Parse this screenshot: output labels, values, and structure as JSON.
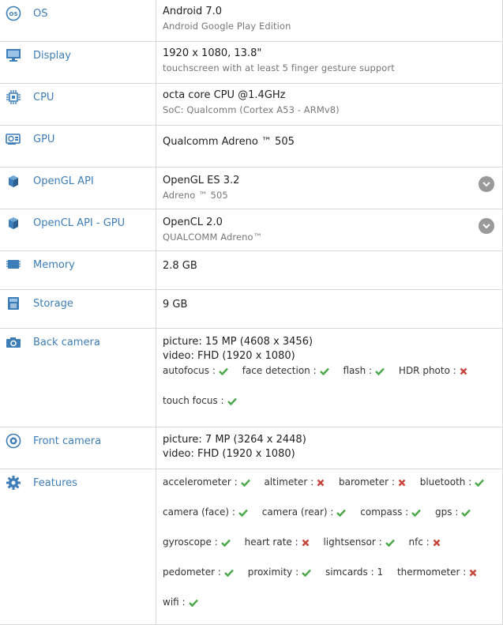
{
  "rows": {
    "os": {
      "label": "OS",
      "main": "Android 7.0",
      "sub": "Android Google Play Edition"
    },
    "display": {
      "label": "Display",
      "main": "1920 x 1080, 13.8\"",
      "sub": "touchscreen with at least 5 finger gesture support"
    },
    "cpu": {
      "label": "CPU",
      "main": "octa core CPU @1.4GHz",
      "sub": "SoC: Qualcomm (Cortex A53 - ARMv8)"
    },
    "gpu": {
      "label": "GPU",
      "main": "Qualcomm Adreno ™ 505"
    },
    "opengl": {
      "label": "OpenGL API",
      "main": "OpenGL ES 3.2",
      "sub": "Adreno ™ 505"
    },
    "opencl": {
      "label": "OpenCL API - GPU",
      "main": "OpenCL 2.0",
      "sub": "QUALCOMM Adreno™"
    },
    "memory": {
      "label": "Memory",
      "main": "2.8 GB"
    },
    "storage": {
      "label": "Storage",
      "main": "9 GB"
    },
    "back_camera": {
      "label": "Back camera",
      "picture": "picture: 15 MP (4608 x 3456)",
      "video": "video: FHD (1920 x 1080)",
      "features": [
        {
          "name": "autofocus :",
          "status": "yes"
        },
        {
          "name": "face detection :",
          "status": "yes"
        },
        {
          "name": "flash :",
          "status": "yes"
        },
        {
          "name": "HDR photo :",
          "status": "no"
        },
        {
          "name": "touch focus :",
          "status": "yes"
        }
      ]
    },
    "front_camera": {
      "label": "Front camera",
      "picture": "picture: 7 MP (3264 x 2448)",
      "video": "video: FHD (1920 x 1080)"
    },
    "features": {
      "label": "Features",
      "items": [
        {
          "name": "accelerometer :",
          "status": "yes"
        },
        {
          "name": "altimeter :",
          "status": "no"
        },
        {
          "name": "barometer :",
          "status": "no"
        },
        {
          "name": "bluetooth :",
          "status": "yes"
        },
        {
          "name": "camera (face) :",
          "status": "yes"
        },
        {
          "name": "camera (rear) :",
          "status": "yes"
        },
        {
          "name": "compass :",
          "status": "yes"
        },
        {
          "name": "gps :",
          "status": "yes"
        },
        {
          "name": "gyroscope :",
          "status": "yes"
        },
        {
          "name": "heart rate :",
          "status": "no"
        },
        {
          "name": "lightsensor :",
          "status": "yes"
        },
        {
          "name": "nfc :",
          "status": "no"
        },
        {
          "name": "pedometer :",
          "status": "yes"
        },
        {
          "name": "proximity :",
          "status": "yes"
        },
        {
          "name": "simcards :",
          "value": "1"
        },
        {
          "name": "thermometer :",
          "status": "no"
        },
        {
          "name": "wifi :",
          "status": "yes"
        }
      ]
    }
  },
  "colors": {
    "label": "#3d7db8",
    "icon": "#3d7db8",
    "yes": "#4aa84a",
    "no": "#c8433a",
    "border": "#d8d8d8"
  }
}
